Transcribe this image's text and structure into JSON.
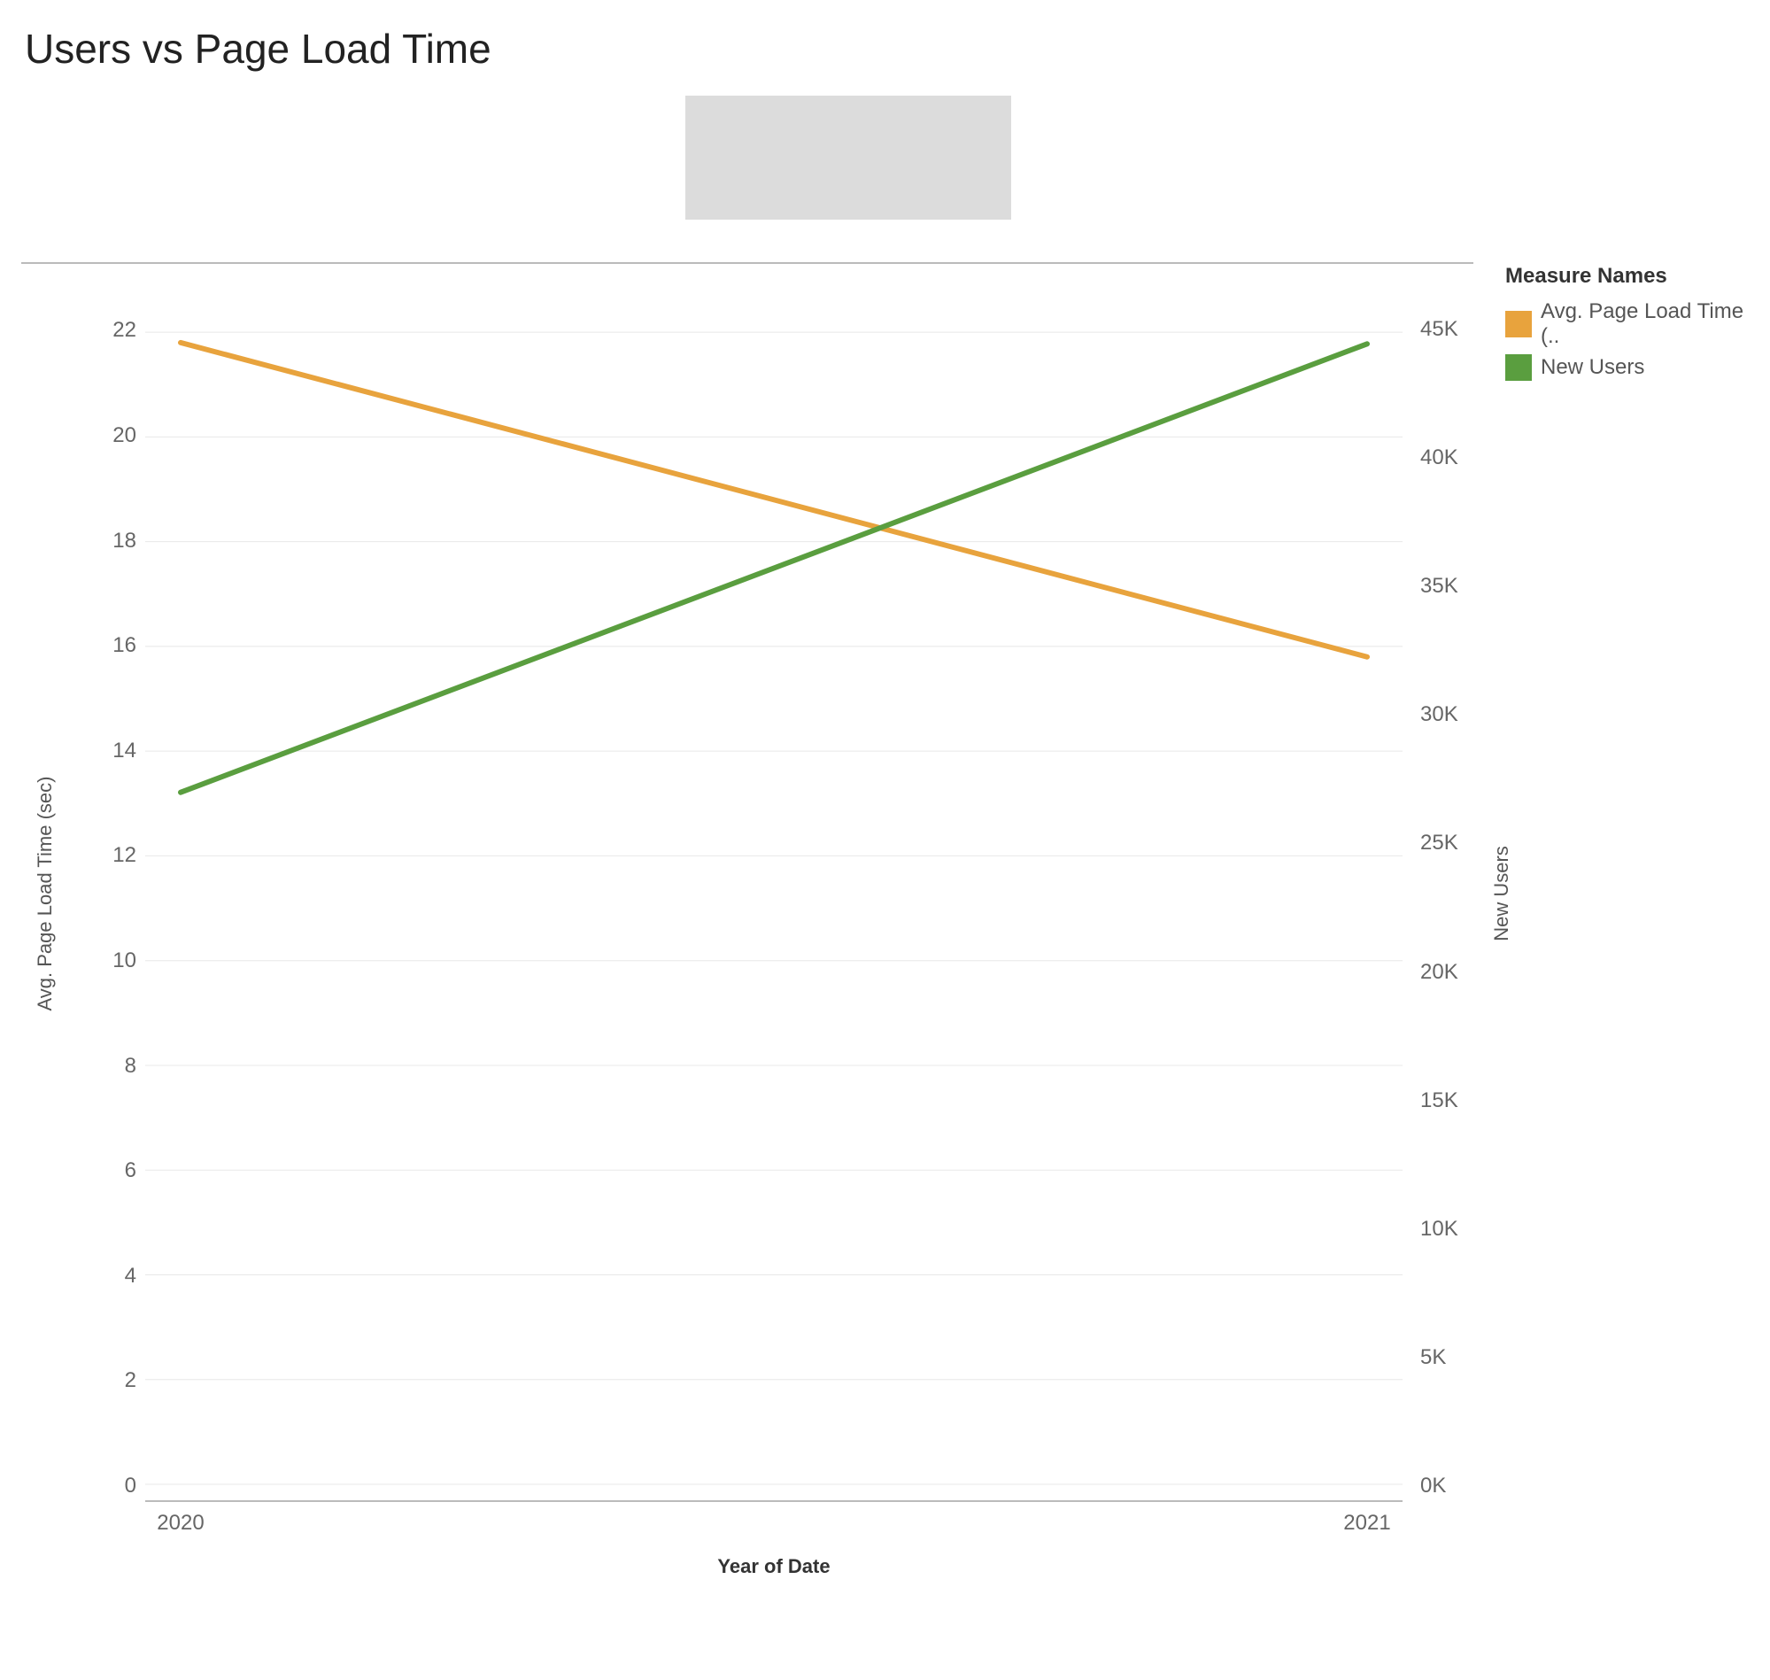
{
  "title": "Users vs Page Load Time",
  "legend": {
    "title": "Measure Names",
    "items": [
      {
        "label": "Avg. Page Load Time (..",
        "color": "#e8a33d"
      },
      {
        "label": "New Users",
        "color": "#5a9e3f"
      }
    ]
  },
  "axes": {
    "xlabel": "Year of Date",
    "y_left_label": "Avg. Page Load Time (sec)",
    "y_right_label": "New Users",
    "x_ticks": [
      "2020",
      "2021"
    ],
    "y_left_ticks": [
      0,
      2,
      4,
      6,
      8,
      10,
      12,
      14,
      16,
      18,
      20,
      22
    ],
    "y_right_ticks": [
      "0K",
      "5K",
      "10K",
      "15K",
      "20K",
      "25K",
      "30K",
      "35K",
      "40K",
      "45K"
    ]
  },
  "chart_data": {
    "type": "line",
    "dual_axis": true,
    "x": [
      "2020",
      "2021"
    ],
    "series": [
      {
        "name": "Avg. Page Load Time (sec)",
        "axis": "left",
        "color": "#e8a33d",
        "values": [
          21.8,
          15.8
        ]
      },
      {
        "name": "New Users",
        "axis": "right",
        "color": "#5a9e3f",
        "values": [
          27000,
          44500
        ]
      }
    ],
    "y_left_range": [
      0,
      23
    ],
    "y_right_range": [
      0,
      47000
    ],
    "xlabel": "Year of Date",
    "y_left_label": "Avg. Page Load Time (sec)",
    "y_right_label": "New Users",
    "title": "Users vs Page Load Time"
  }
}
